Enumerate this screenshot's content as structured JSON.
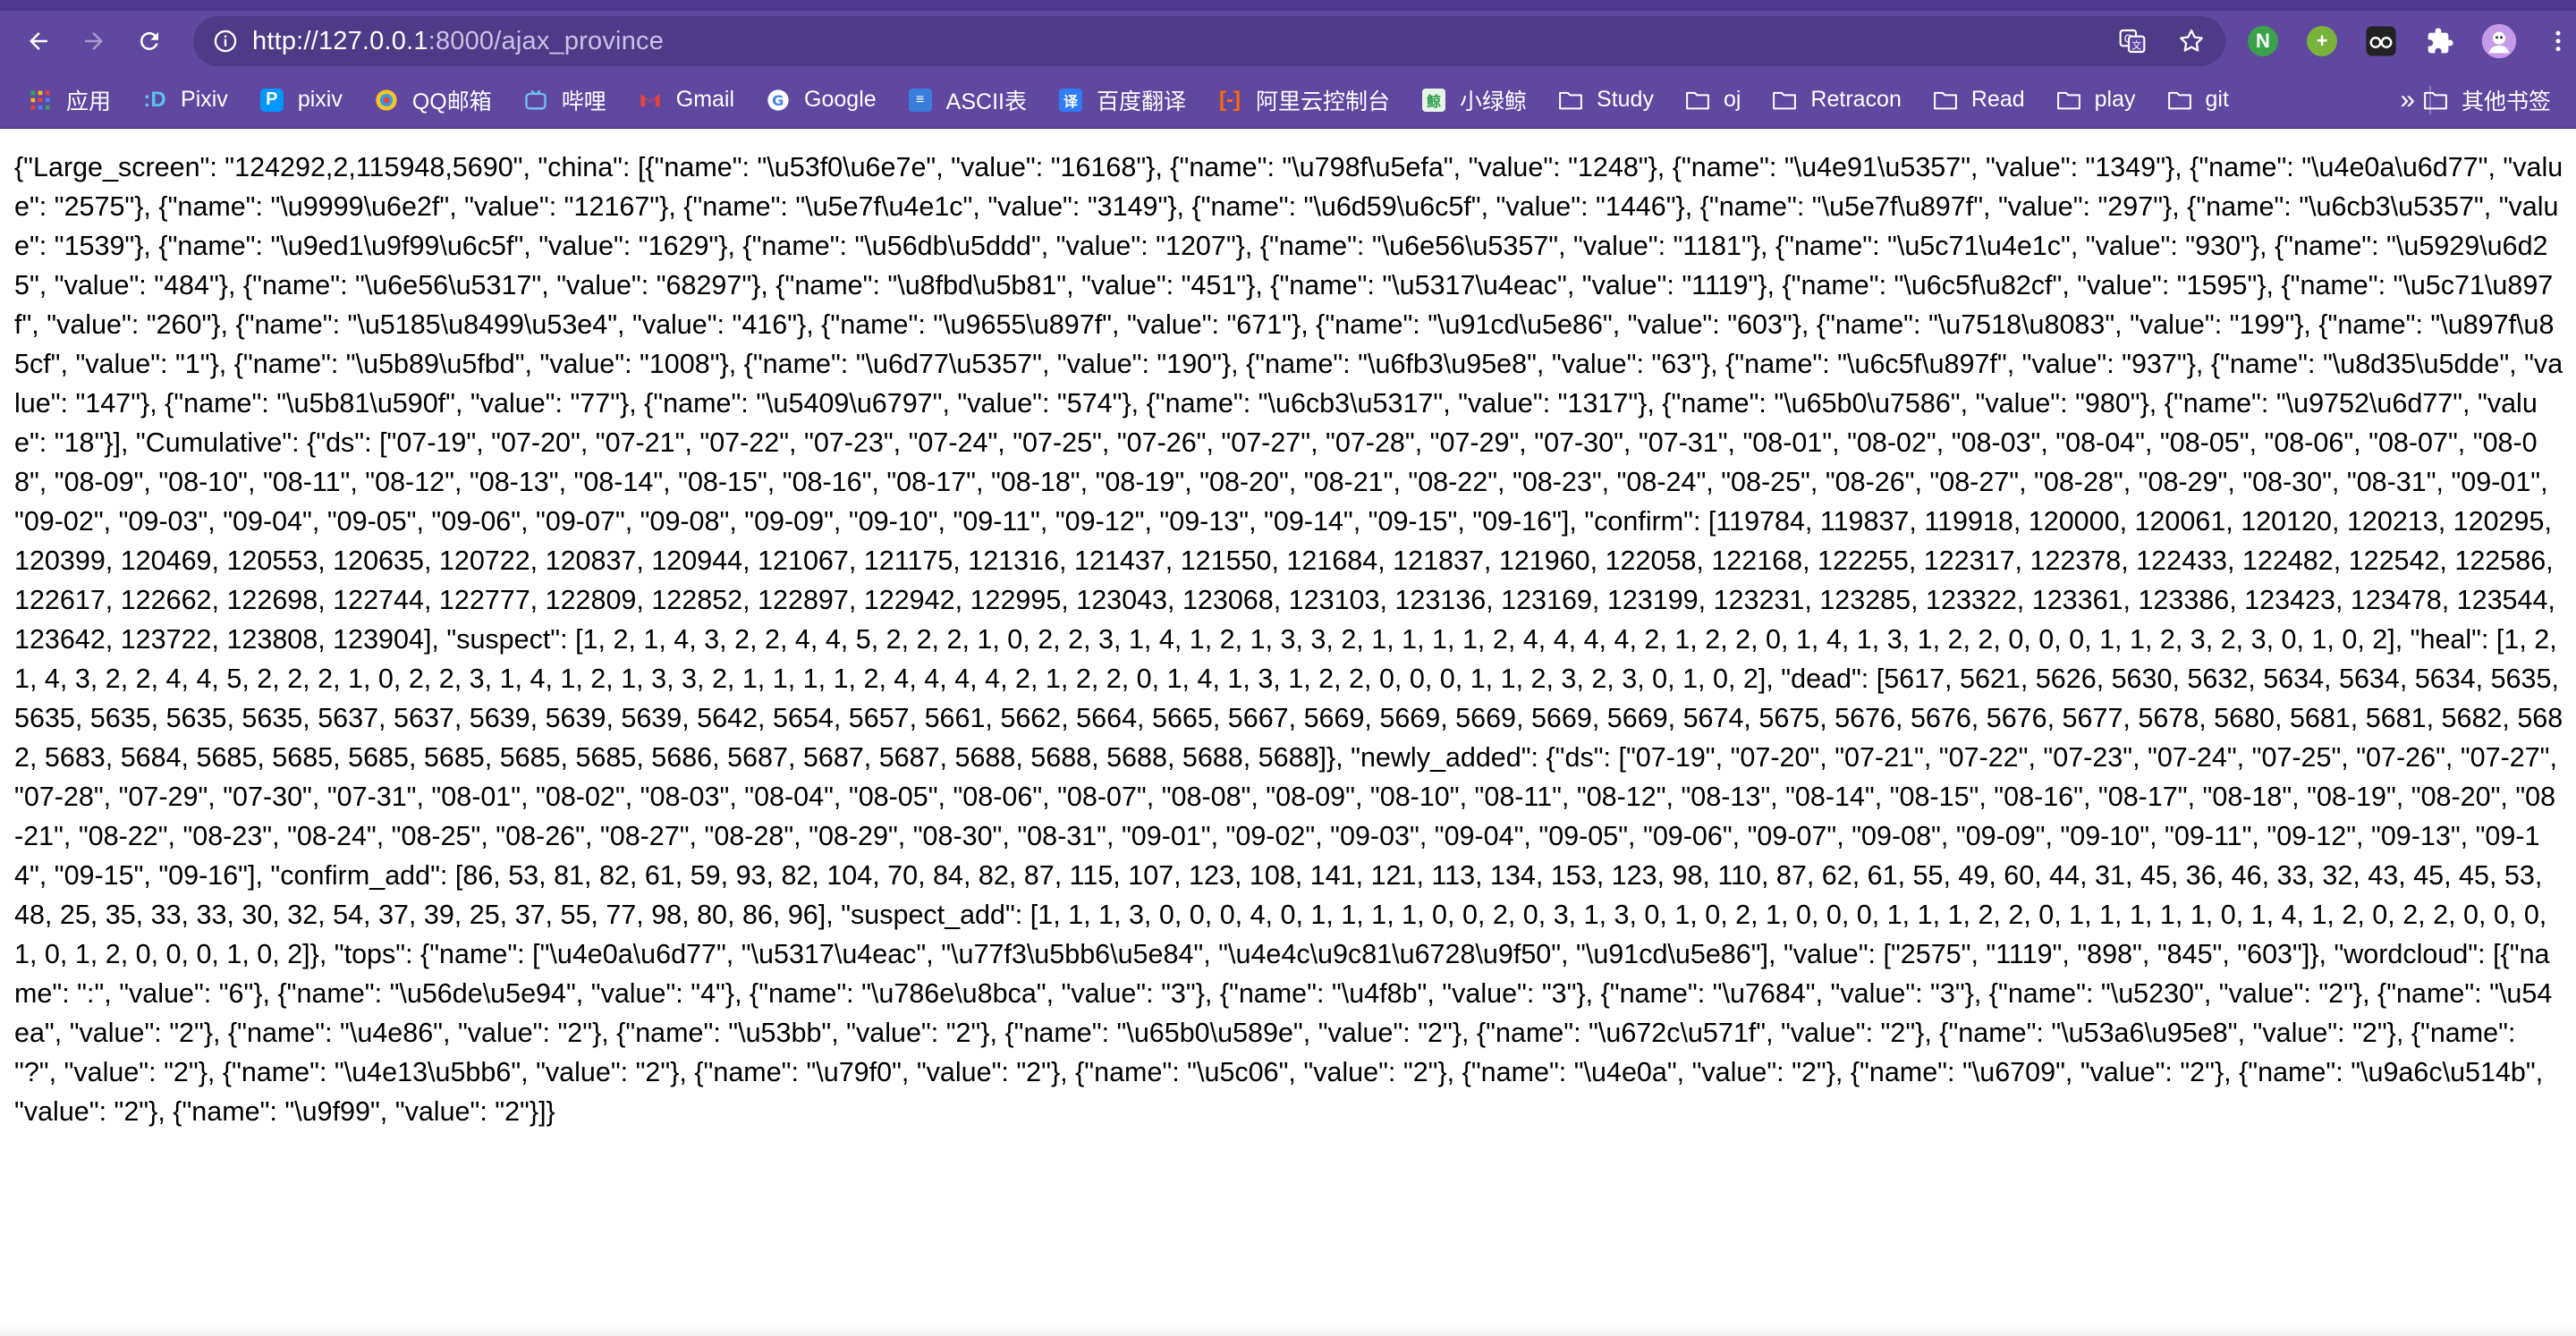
{
  "browser": {
    "url_host": "http://127.0.0.1",
    "url_path": ":8000/ajax_province",
    "nav": {
      "back_icon": "arrow-left-icon",
      "forward_icon": "arrow-right-icon",
      "reload_icon": "reload-icon"
    },
    "omnibox_icons": [
      "info-icon",
      "translate-icon",
      "star-icon"
    ],
    "extensions": [
      "green-extension-icon",
      "plus-extension-icon",
      "glasses-extension-icon",
      "puzzle-icon",
      "profile-avatar-icon",
      "menu-dots-icon"
    ],
    "accent_color": "#60479f"
  },
  "bookmarks": [
    {
      "label": "应用",
      "icon": "apps-grid-icon"
    },
    {
      "label": "Pixiv",
      "icon": "pixiv-d-icon"
    },
    {
      "label": "pixiv",
      "icon": "pixiv-p-icon"
    },
    {
      "label": "QQ邮箱",
      "icon": "qq-mail-icon"
    },
    {
      "label": "哔哩",
      "icon": "bilibili-icon"
    },
    {
      "label": "Gmail",
      "icon": "gmail-icon"
    },
    {
      "label": "Google",
      "icon": "google-icon"
    },
    {
      "label": "ASCII表",
      "icon": "ascii-icon"
    },
    {
      "label": "百度翻译",
      "icon": "baidu-translate-icon"
    },
    {
      "label": "阿里云控制台",
      "icon": "aliyun-icon"
    },
    {
      "label": "小绿鲸",
      "icon": "xiaolvjing-icon"
    },
    {
      "label": "Study",
      "icon": "folder-icon"
    },
    {
      "label": "oj",
      "icon": "folder-icon"
    },
    {
      "label": "Retracon",
      "icon": "folder-icon"
    },
    {
      "label": "Read",
      "icon": "folder-icon"
    },
    {
      "label": "play",
      "icon": "folder-icon"
    },
    {
      "label": "git",
      "icon": "folder-icon"
    }
  ],
  "bookmarks_more": "»",
  "other_bookmarks": "其他书签",
  "body_text": "{\"Large_screen\": \"124292,2,115948,5690\", \"china\": [{\"name\": \"\\u53f0\\u6e7e\", \"value\": \"16168\"}, {\"name\": \"\\u798f\\u5efa\", \"value\": \"1248\"}, {\"name\": \"\\u4e91\\u5357\", \"value\": \"1349\"}, {\"name\": \"\\u4e0a\\u6d77\", \"value\": \"2575\"}, {\"name\": \"\\u9999\\u6e2f\", \"value\": \"12167\"}, {\"name\": \"\\u5e7f\\u4e1c\", \"value\": \"3149\"}, {\"name\": \"\\u6d59\\u6c5f\", \"value\": \"1446\"}, {\"name\": \"\\u5e7f\\u897f\", \"value\": \"297\"}, {\"name\": \"\\u6cb3\\u5357\", \"value\": \"1539\"}, {\"name\": \"\\u9ed1\\u9f99\\u6c5f\", \"value\": \"1629\"}, {\"name\": \"\\u56db\\u5ddd\", \"value\": \"1207\"}, {\"name\": \"\\u6e56\\u5357\", \"value\": \"1181\"}, {\"name\": \"\\u5c71\\u4e1c\", \"value\": \"930\"}, {\"name\": \"\\u5929\\u6d25\", \"value\": \"484\"}, {\"name\": \"\\u6e56\\u5317\", \"value\": \"68297\"}, {\"name\": \"\\u8fbd\\u5b81\", \"value\": \"451\"}, {\"name\": \"\\u5317\\u4eac\", \"value\": \"1119\"}, {\"name\": \"\\u6c5f\\u82cf\", \"value\": \"1595\"}, {\"name\": \"\\u5c71\\u897f\", \"value\": \"260\"}, {\"name\": \"\\u5185\\u8499\\u53e4\", \"value\": \"416\"}, {\"name\": \"\\u9655\\u897f\", \"value\": \"671\"}, {\"name\": \"\\u91cd\\u5e86\", \"value\": \"603\"}, {\"name\": \"\\u7518\\u8083\", \"value\": \"199\"}, {\"name\": \"\\u897f\\u85cf\", \"value\": \"1\"}, {\"name\": \"\\u5b89\\u5fbd\", \"value\": \"1008\"}, {\"name\": \"\\u6d77\\u5357\", \"value\": \"190\"}, {\"name\": \"\\u6fb3\\u95e8\", \"value\": \"63\"}, {\"name\": \"\\u6c5f\\u897f\", \"value\": \"937\"}, {\"name\": \"\\u8d35\\u5dde\", \"value\": \"147\"}, {\"name\": \"\\u5b81\\u590f\", \"value\": \"77\"}, {\"name\": \"\\u5409\\u6797\", \"value\": \"574\"}, {\"name\": \"\\u6cb3\\u5317\", \"value\": \"1317\"}, {\"name\": \"\\u65b0\\u7586\", \"value\": \"980\"}, {\"name\": \"\\u9752\\u6d77\", \"value\": \"18\"}], \"Cumulative\": {\"ds\": [\"07-19\", \"07-20\", \"07-21\", \"07-22\", \"07-23\", \"07-24\", \"07-25\", \"07-26\", \"07-27\", \"07-28\", \"07-29\", \"07-30\", \"07-31\", \"08-01\", \"08-02\", \"08-03\", \"08-04\", \"08-05\", \"08-06\", \"08-07\", \"08-08\", \"08-09\", \"08-10\", \"08-11\", \"08-12\", \"08-13\", \"08-14\", \"08-15\", \"08-16\", \"08-17\", \"08-18\", \"08-19\", \"08-20\", \"08-21\", \"08-22\", \"08-23\", \"08-24\", \"08-25\", \"08-26\", \"08-27\", \"08-28\", \"08-29\", \"08-30\", \"08-31\", \"09-01\", \"09-02\", \"09-03\", \"09-04\", \"09-05\", \"09-06\", \"09-07\", \"09-08\", \"09-09\", \"09-10\", \"09-11\", \"09-12\", \"09-13\", \"09-14\", \"09-15\", \"09-16\"], \"confirm\": [119784, 119837, 119918, 120000, 120061, 120120, 120213, 120295, 120399, 120469, 120553, 120635, 120722, 120837, 120944, 121067, 121175, 121316, 121437, 121550, 121684, 121837, 121960, 122058, 122168, 122255, 122317, 122378, 122433, 122482, 122542, 122586, 122617, 122662, 122698, 122744, 122777, 122809, 122852, 122897, 122942, 122995, 123043, 123068, 123103, 123136, 123169, 123199, 123231, 123285, 123322, 123361, 123386, 123423, 123478, 123544, 123642, 123722, 123808, 123904], \"suspect\": [1, 2, 1, 4, 3, 2, 2, 4, 4, 5, 2, 2, 2, 1, 0, 2, 2, 3, 1, 4, 1, 2, 1, 3, 3, 2, 1, 1, 1, 1, 2, 4, 4, 4, 4, 2, 1, 2, 2, 0, 1, 4, 1, 3, 1, 2, 2, 0, 0, 0, 1, 1, 2, 3, 2, 3, 0, 1, 0, 2], \"heal\": [1, 2, 1, 4, 3, 2, 2, 4, 4, 5, 2, 2, 2, 1, 0, 2, 2, 3, 1, 4, 1, 2, 1, 3, 3, 2, 1, 1, 1, 1, 2, 4, 4, 4, 4, 2, 1, 2, 2, 0, 1, 4, 1, 3, 1, 2, 2, 0, 0, 0, 1, 1, 2, 3, 2, 3, 0, 1, 0, 2], \"dead\": [5617, 5621, 5626, 5630, 5632, 5634, 5634, 5634, 5635, 5635, 5635, 5635, 5635, 5637, 5637, 5639, 5639, 5639, 5642, 5654, 5657, 5661, 5662, 5664, 5665, 5667, 5669, 5669, 5669, 5669, 5669, 5674, 5675, 5676, 5676, 5676, 5677, 5678, 5680, 5681, 5681, 5682, 5682, 5683, 5684, 5685, 5685, 5685, 5685, 5685, 5685, 5686, 5687, 5687, 5687, 5688, 5688, 5688, 5688, 5688]}, \"newly_added\": {\"ds\": [\"07-19\", \"07-20\", \"07-21\", \"07-22\", \"07-23\", \"07-24\", \"07-25\", \"07-26\", \"07-27\", \"07-28\", \"07-29\", \"07-30\", \"07-31\", \"08-01\", \"08-02\", \"08-03\", \"08-04\", \"08-05\", \"08-06\", \"08-07\", \"08-08\", \"08-09\", \"08-10\", \"08-11\", \"08-12\", \"08-13\", \"08-14\", \"08-15\", \"08-16\", \"08-17\", \"08-18\", \"08-19\", \"08-20\", \"08-21\", \"08-22\", \"08-23\", \"08-24\", \"08-25\", \"08-26\", \"08-27\", \"08-28\", \"08-29\", \"08-30\", \"08-31\", \"09-01\", \"09-02\", \"09-03\", \"09-04\", \"09-05\", \"09-06\", \"09-07\", \"09-08\", \"09-09\", \"09-10\", \"09-11\", \"09-12\", \"09-13\", \"09-14\", \"09-15\", \"09-16\"], \"confirm_add\": [86, 53, 81, 82, 61, 59, 93, 82, 104, 70, 84, 82, 87, 115, 107, 123, 108, 141, 121, 113, 134, 153, 123, 98, 110, 87, 62, 61, 55, 49, 60, 44, 31, 45, 36, 46, 33, 32, 43, 45, 45, 53, 48, 25, 35, 33, 33, 30, 32, 54, 37, 39, 25, 37, 55, 77, 98, 80, 86, 96], \"suspect_add\": [1, 1, 1, 3, 0, 0, 0, 4, 0, 1, 1, 1, 1, 0, 0, 2, 0, 3, 1, 3, 0, 1, 0, 2, 1, 0, 0, 0, 1, 1, 1, 2, 2, 0, 1, 1, 1, 1, 1, 0, 1, 4, 1, 2, 0, 2, 2, 0, 0, 0, 1, 0, 1, 2, 0, 0, 0, 1, 0, 2]}, \"tops\": {\"name\": [\"\\u4e0a\\u6d77\", \"\\u5317\\u4eac\", \"\\u77f3\\u5bb6\\u5e84\", \"\\u4e4c\\u9c81\\u6728\\u9f50\", \"\\u91cd\\u5e86\"], \"value\": [\"2575\", \"1119\", \"898\", \"845\", \"603\"]}, \"wordcloud\": [{\"name\": \":\", \"value\": \"6\"}, {\"name\": \"\\u56de\\u5e94\", \"value\": \"4\"}, {\"name\": \"\\u786e\\u8bca\", \"value\": \"3\"}, {\"name\": \"\\u4f8b\", \"value\": \"3\"}, {\"name\": \"\\u7684\", \"value\": \"3\"}, {\"name\": \"\\u5230\", \"value\": \"2\"}, {\"name\": \"\\u54ea\", \"value\": \"2\"}, {\"name\": \"\\u4e86\", \"value\": \"2\"}, {\"name\": \"\\u53bb\", \"value\": \"2\"}, {\"name\": \"\\u65b0\\u589e\", \"value\": \"2\"}, {\"name\": \"\\u672c\\u571f\", \"value\": \"2\"}, {\"name\": \"\\u53a6\\u95e8\", \"value\": \"2\"}, {\"name\": \"?\", \"value\": \"2\"}, {\"name\": \"\\u4e13\\u5bb6\", \"value\": \"2\"}, {\"name\": \"\\u79f0\", \"value\": \"2\"}, {\"name\": \"\\u5c06\", \"value\": \"2\"}, {\"name\": \"\\u4e0a\", \"value\": \"2\"}, {\"name\": \"\\u6709\", \"value\": \"2\"}, {\"name\": \"\\u9a6c\\u514b\", \"value\": \"2\"}, {\"name\": \"\\u9f99\", \"value\": \"2\"}]}"
}
